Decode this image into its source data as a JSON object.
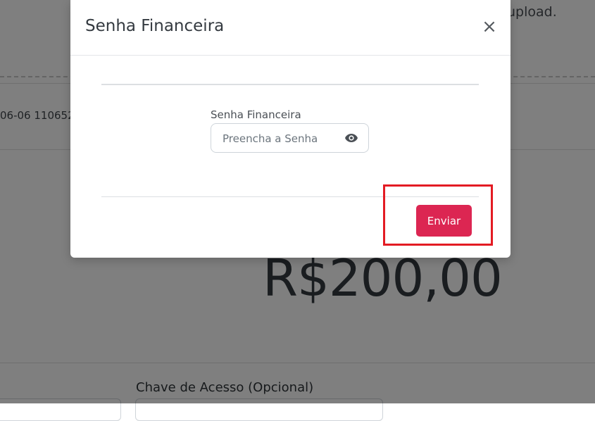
{
  "background": {
    "upload_text": "upload.",
    "id_text": "06-06 110652",
    "amount": "R$200,00",
    "access_key_label": "Chave de Acesso (Opcional)"
  },
  "modal": {
    "title": "Senha Financeira",
    "close_glyph": "×",
    "field_label": "Senha Financeira",
    "password_placeholder": "Preencha a Senha",
    "password_value": "",
    "submit_label": "Enviar"
  },
  "icons": {
    "close": "close-icon",
    "show_password": "eye-icon"
  },
  "colors": {
    "submit_button": "#dc2652",
    "highlight_box": "#e31b23",
    "overlay": "rgba(0,0,0,0.5)"
  }
}
